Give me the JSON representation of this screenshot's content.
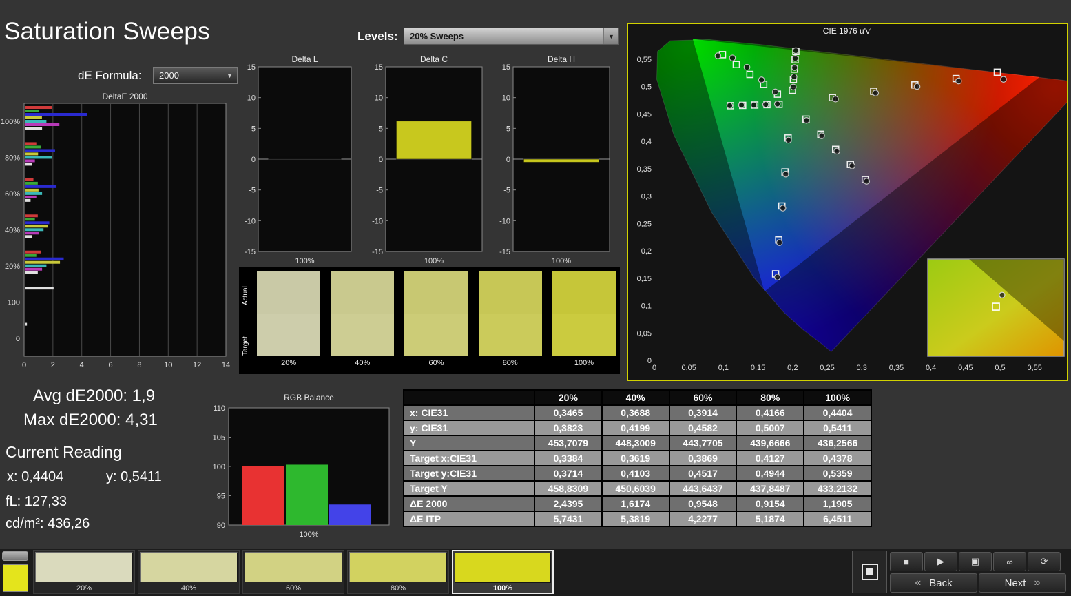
{
  "header": {
    "title": "Saturation Sweeps",
    "de_formula_label": "dE Formula:",
    "de_formula_value": "2000",
    "levels_label": "Levels:",
    "levels_value": "20% Sweeps"
  },
  "icons": {
    "chevron_down": "▼"
  },
  "readings": {
    "avg": "Avg dE2000: 1,9",
    "max": "Max dE2000: 4,31",
    "current_reading_label": "Current Reading",
    "x": "x: 0,4404",
    "y": "y: 0,5411",
    "fl": "fL: 127,33",
    "cdm2": "cd/m²: 436,26"
  },
  "swatch_panel": {
    "actual_label": "Actual",
    "target_label": "Target",
    "items": [
      {
        "label": "20%",
        "actual": "#c9c9a6",
        "target": "#cdcdab"
      },
      {
        "label": "40%",
        "actual": "#c9c98e",
        "target": "#cdcd93"
      },
      {
        "label": "60%",
        "actual": "#c8c872",
        "target": "#cccc77"
      },
      {
        "label": "80%",
        "actual": "#c7c756",
        "target": "#cbcb5b"
      },
      {
        "label": "100%",
        "actual": "#c6c639",
        "target": "#cbcb3f"
      }
    ]
  },
  "bottom_bar": {
    "current_patch_color": "#e4e41c",
    "patches": [
      {
        "label": "20%",
        "color": "#dadabd",
        "selected": false
      },
      {
        "label": "40%",
        "color": "#d6d6a0",
        "selected": false
      },
      {
        "label": "60%",
        "color": "#d2d283",
        "selected": false
      },
      {
        "label": "80%",
        "color": "#d2d260",
        "selected": false
      },
      {
        "label": "100%",
        "color": "#d8d81e",
        "selected": true
      }
    ],
    "transport": [
      {
        "name": "stop-button",
        "glyph": "■"
      },
      {
        "name": "play-button",
        "glyph": "▶"
      },
      {
        "name": "capture-button",
        "glyph": "▣"
      },
      {
        "name": "continuous-button",
        "glyph": "∞"
      },
      {
        "name": "refresh-button",
        "glyph": "⟳"
      }
    ],
    "back_chevron": "«",
    "back_label": "Back",
    "next_label": "Next",
    "next_chevron": "»"
  },
  "chart_data": [
    {
      "id": "deltae2000",
      "type": "bar",
      "orientation": "horizontal",
      "title": "DeltaE 2000",
      "x_ticks": [
        0,
        2,
        4,
        6,
        8,
        10,
        12,
        14
      ],
      "xlim": [
        0,
        14
      ],
      "series_colors": {
        "red": "#cf3a3a",
        "green": "#3aa83a",
        "blue": "#2a2ad0",
        "yellow": "#c8c83a",
        "cyan": "#3ab8b8",
        "magenta": "#b83ab8",
        "white": "#e0e0e0"
      },
      "groups": [
        {
          "label": "100%",
          "bars": [
            [
              "red",
              1.9
            ],
            [
              "green",
              1.0
            ],
            [
              "blue",
              4.31
            ],
            [
              "yellow",
              1.19
            ],
            [
              "cyan",
              1.5
            ],
            [
              "magenta",
              2.4
            ],
            [
              "white",
              1.2
            ]
          ]
        },
        {
          "label": "80%",
          "bars": [
            [
              "red",
              0.8
            ],
            [
              "green",
              1.1
            ],
            [
              "blue",
              2.1
            ],
            [
              "yellow",
              0.92
            ],
            [
              "cyan",
              1.9
            ],
            [
              "magenta",
              0.7
            ],
            [
              "white",
              0.5
            ]
          ]
        },
        {
          "label": "60%",
          "bars": [
            [
              "red",
              0.6
            ],
            [
              "green",
              0.9
            ],
            [
              "blue",
              2.2
            ],
            [
              "yellow",
              0.95
            ],
            [
              "cyan",
              1.2
            ],
            [
              "magenta",
              0.8
            ],
            [
              "white",
              0.4
            ]
          ]
        },
        {
          "label": "40%",
          "bars": [
            [
              "red",
              0.9
            ],
            [
              "green",
              0.7
            ],
            [
              "blue",
              1.7
            ],
            [
              "yellow",
              1.62
            ],
            [
              "cyan",
              1.3
            ],
            [
              "magenta",
              1.0
            ],
            [
              "white",
              0.5
            ]
          ]
        },
        {
          "label": "20%",
          "bars": [
            [
              "red",
              1.1
            ],
            [
              "green",
              0.8
            ],
            [
              "blue",
              2.7
            ],
            [
              "yellow",
              2.44
            ],
            [
              "cyan",
              1.5
            ],
            [
              "magenta",
              1.2
            ],
            [
              "white",
              0.9
            ]
          ]
        },
        {
          "label": "100",
          "bars": [
            [
              "white",
              2.0
            ]
          ]
        },
        {
          "label": "0",
          "bars": [
            [
              "white",
              0.15
            ]
          ]
        }
      ]
    },
    {
      "id": "delta_l",
      "type": "bar",
      "title": "Delta L",
      "categories": [
        "100%"
      ],
      "values": [
        0.3
      ],
      "color": "#141414",
      "ylim": [
        -15,
        15
      ],
      "y_ticks": [
        15,
        10,
        5,
        0,
        -5,
        -10,
        -15
      ]
    },
    {
      "id": "delta_c",
      "type": "bar",
      "title": "Delta C",
      "categories": [
        "100%"
      ],
      "values": [
        6.2
      ],
      "color": "#c8c81e",
      "ylim": [
        -15,
        15
      ],
      "y_ticks": [
        15,
        10,
        5,
        0,
        -5,
        -10,
        -15
      ]
    },
    {
      "id": "delta_h",
      "type": "bar",
      "title": "Delta H",
      "categories": [
        "100%"
      ],
      "values": [
        -0.5
      ],
      "color": "#c8c81e",
      "ylim": [
        -15,
        15
      ],
      "y_ticks": [
        15,
        10,
        5,
        0,
        -5,
        -10,
        -15
      ]
    },
    {
      "id": "cie",
      "type": "scatter",
      "title": "CIE 1976 u'v'",
      "tick_values": [
        0,
        0.05,
        0.1,
        0.15,
        0.2,
        0.25,
        0.3,
        0.35,
        0.4,
        0.45,
        0.5,
        0.55
      ],
      "tick_labels": [
        "0",
        "0,05",
        "0,1",
        "0,15",
        "0,2",
        "0,25",
        "0,3",
        "0,35",
        "0,4",
        "0,45",
        "0,5",
        "0,55"
      ],
      "locus": [
        [
          0.2557,
          0.0159
        ],
        [
          0.2446,
          0.0277
        ],
        [
          0.216,
          0.055
        ],
        [
          0.1877,
          0.0871
        ],
        [
          0.1441,
          0.151
        ],
        [
          0.0828,
          0.2708
        ],
        [
          0.0282,
          0.4117
        ],
        [
          0.0035,
          0.5131
        ],
        [
          0.0046,
          0.5639
        ],
        [
          0.0231,
          0.5837
        ],
        [
          0.0792,
          0.5856
        ],
        [
          0.1531,
          0.5766
        ],
        [
          0.2623,
          0.5604
        ],
        [
          0.4035,
          0.5393
        ],
        [
          0.5203,
          0.5219
        ],
        [
          0.6234,
          0.5065
        ]
      ],
      "gamut_triangle": [
        [
          0.557,
          0.517
        ],
        [
          0.0556,
          0.5868
        ],
        [
          0.1593,
          0.1258
        ]
      ],
      "gradient_colors": {
        "red": "#ff2000",
        "green": "#00dc00",
        "blue": "#1e00ff"
      },
      "sweeps": [
        {
          "name": "yellow",
          "targets": [
            [
              0.1997,
              0.493
            ],
            [
              0.2011,
              0.5129
            ],
            [
              0.2024,
              0.5316
            ],
            [
              0.2036,
              0.5488
            ],
            [
              0.2047,
              0.5638
            ]
          ],
          "actuals": [
            [
              0.201,
              0.499
            ],
            [
              0.2021,
              0.5176
            ],
            [
              0.2029,
              0.5345
            ],
            [
              0.2038,
              0.5512
            ],
            [
              0.2046,
              0.5655
            ]
          ]
        },
        {
          "name": "red",
          "targets": [
            [
              0.2576,
              0.4796
            ],
            [
              0.3172,
              0.4912
            ],
            [
              0.3768,
              0.5028
            ],
            [
              0.4364,
              0.5144
            ],
            [
              0.496,
              0.526
            ]
          ],
          "actuals": [
            [
              0.262,
              0.477
            ],
            [
              0.32,
              0.488
            ],
            [
              0.38,
              0.5
            ],
            [
              0.44,
              0.51
            ],
            [
              0.505,
              0.513
            ]
          ]
        },
        {
          "name": "green",
          "targets": [
            [
              0.1781,
              0.486
            ],
            [
              0.1582,
              0.504
            ],
            [
              0.1383,
              0.522
            ],
            [
              0.1185,
              0.54
            ],
            [
              0.0986,
              0.558
            ]
          ],
          "actuals": [
            [
              0.175,
              0.49
            ],
            [
              0.155,
              0.512
            ],
            [
              0.134,
              0.535
            ],
            [
              0.113,
              0.552
            ],
            [
              0.092,
              0.556
            ]
          ]
        },
        {
          "name": "blue",
          "targets": [
            [
              0.1935,
              0.4059
            ],
            [
              0.189,
              0.3439
            ],
            [
              0.1845,
              0.2818
            ],
            [
              0.1799,
              0.2198
            ],
            [
              0.1754,
              0.1579
            ]
          ],
          "actuals": [
            [
              0.194,
              0.402
            ],
            [
              0.19,
              0.34
            ],
            [
              0.186,
              0.278
            ],
            [
              0.181,
              0.215
            ],
            [
              0.178,
              0.152
            ]
          ]
        },
        {
          "name": "cyan",
          "targets": [
            [
              0.1804,
              0.4674
            ],
            [
              0.1629,
              0.4668
            ],
            [
              0.1453,
              0.4661
            ],
            [
              0.1278,
              0.4655
            ],
            [
              0.1103,
              0.4649
            ]
          ],
          "actuals": [
            [
              0.178,
              0.468
            ],
            [
              0.161,
              0.467
            ],
            [
              0.144,
              0.466
            ],
            [
              0.126,
              0.466
            ],
            [
              0.109,
              0.465
            ]
          ]
        },
        {
          "name": "magenta",
          "targets": [
            [
              0.2194,
              0.4404
            ],
            [
              0.2408,
              0.4128
            ],
            [
              0.2622,
              0.3852
            ],
            [
              0.2836,
              0.3576
            ],
            [
              0.305,
              0.33
            ]
          ],
          "actuals": [
            [
              0.22,
              0.438
            ],
            [
              0.242,
              0.41
            ],
            [
              0.264,
              0.382
            ],
            [
              0.286,
              0.355
            ],
            [
              0.307,
              0.327
            ]
          ]
        }
      ],
      "inset": {
        "gradient": [
          "#9ccb12",
          "#cbcb1c",
          "#df9400"
        ],
        "square": [
          0.5,
          0.49
        ],
        "circle": [
          0.545,
          0.37
        ]
      }
    },
    {
      "id": "rgb_balance",
      "type": "bar",
      "title": "RGB Balance",
      "categories": [
        "Red",
        "Green",
        "Blue"
      ],
      "values": [
        100,
        100.3,
        93.5
      ],
      "colors": [
        "#e83232",
        "#2eb82e",
        "#4343e8"
      ],
      "ylim": [
        90,
        110
      ],
      "y_ticks": [
        110,
        105,
        100,
        95,
        90
      ],
      "x_label": "100%"
    },
    {
      "id": "saturation_table",
      "type": "table",
      "columns": [
        "",
        "20%",
        "40%",
        "60%",
        "80%",
        "100%"
      ],
      "rows": [
        {
          "label": "x: CIE31",
          "values": [
            "0,3465",
            "0,3688",
            "0,3914",
            "0,4166",
            "0,4404"
          ]
        },
        {
          "label": "y: CIE31",
          "values": [
            "0,3823",
            "0,4199",
            "0,4582",
            "0,5007",
            "0,5411"
          ]
        },
        {
          "label": "Y",
          "values": [
            "453,7079",
            "448,3009",
            "443,7705",
            "439,6666",
            "436,2566"
          ]
        },
        {
          "label": "Target x:CIE31",
          "values": [
            "0,3384",
            "0,3619",
            "0,3869",
            "0,4127",
            "0,4378"
          ]
        },
        {
          "label": "Target y:CIE31",
          "values": [
            "0,3714",
            "0,4103",
            "0,4517",
            "0,4944",
            "0,5359"
          ]
        },
        {
          "label": "Target Y",
          "values": [
            "458,8309",
            "450,6039",
            "443,6437",
            "437,8487",
            "433,2132"
          ]
        },
        {
          "label": "ΔE 2000",
          "values": [
            "2,4395",
            "1,6174",
            "0,9548",
            "0,9154",
            "1,1905"
          ]
        },
        {
          "label": "ΔE ITP",
          "values": [
            "5,7431",
            "5,3819",
            "4,2277",
            "5,1874",
            "6,4511"
          ]
        }
      ]
    }
  ]
}
